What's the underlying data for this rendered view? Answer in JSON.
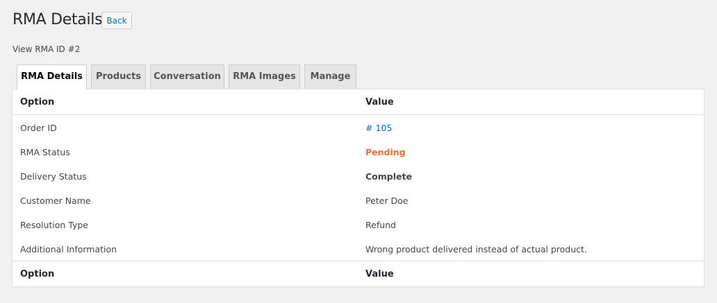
{
  "header": {
    "title": "RMA Details",
    "back_label": "Back",
    "subtitle": "View RMA ID #2"
  },
  "tabs": [
    {
      "label": "RMA Details",
      "active": true
    },
    {
      "label": "Products"
    },
    {
      "label": "Conversation"
    },
    {
      "label": "RMA Images"
    },
    {
      "label": "Manage"
    }
  ],
  "table": {
    "col_option": "Option",
    "col_value": "Value",
    "rows": [
      {
        "option": "Order ID",
        "value": "# 105"
      },
      {
        "option": "RMA Status",
        "value": "Pending"
      },
      {
        "option": "Delivery Status",
        "value": "Complete"
      },
      {
        "option": "Customer Name",
        "value": "Peter Doe"
      },
      {
        "option": "Resolution Type",
        "value": "Refund"
      },
      {
        "option": "Additional Information",
        "value": "Wrong product delivered instead of actual product."
      }
    ]
  },
  "colors": {
    "link": "#0073aa",
    "pending": "#f56e28"
  }
}
